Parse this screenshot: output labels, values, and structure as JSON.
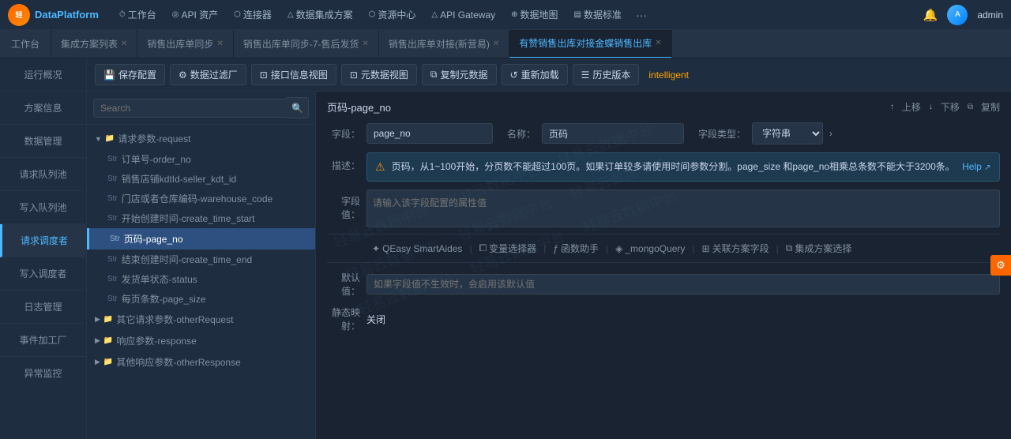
{
  "app": {
    "logo_text": "DataPlatform",
    "logo_short": "轻易云"
  },
  "topnav": {
    "items": [
      {
        "id": "workbench",
        "icon": "⏱",
        "label": "工作台"
      },
      {
        "id": "api",
        "icon": "◎",
        "label": "API 资产"
      },
      {
        "id": "connector",
        "icon": "⬡",
        "label": "连接器"
      },
      {
        "id": "data-integration",
        "icon": "△",
        "label": "数据集成方案"
      },
      {
        "id": "resource",
        "icon": "⬡",
        "label": "资源中心"
      },
      {
        "id": "api-gateway",
        "icon": "△",
        "label": "API Gateway"
      },
      {
        "id": "data-map",
        "icon": "⊕",
        "label": "数据地图"
      },
      {
        "id": "data-standard",
        "icon": "▤",
        "label": "数据标准"
      },
      {
        "id": "more",
        "icon": "···",
        "label": ""
      }
    ],
    "bell_icon": "🔔",
    "username": "admin"
  },
  "tabs": [
    {
      "id": "workbench",
      "label": "工作台",
      "closable": false,
      "active": false
    },
    {
      "id": "solution-list",
      "label": "集成方案列表",
      "closable": true,
      "active": false
    },
    {
      "id": "sales-sync",
      "label": "销售出库单同步",
      "closable": true,
      "active": false
    },
    {
      "id": "sales-sync-7",
      "label": "销售出库单同步-7-售后发货",
      "closable": true,
      "active": false
    },
    {
      "id": "sales-match",
      "label": "销售出库单对接(新营易)",
      "closable": true,
      "active": false
    },
    {
      "id": "sales-jinsale",
      "label": "有赞销售出库对接金蝶销售出库",
      "closable": true,
      "active": true
    }
  ],
  "sidebar": {
    "items": [
      {
        "id": "overview",
        "label": "运行概况",
        "active": false
      },
      {
        "id": "solution-info",
        "label": "方案信息",
        "active": false
      },
      {
        "id": "data-mgmt",
        "label": "数据管理",
        "active": false
      },
      {
        "id": "request-queue",
        "label": "请求队列池",
        "active": false
      },
      {
        "id": "write-queue",
        "label": "写入队列池",
        "active": false
      },
      {
        "id": "request-scheduler",
        "label": "请求调度者",
        "active": true
      },
      {
        "id": "write-scheduler",
        "label": "写入调度者",
        "active": false
      },
      {
        "id": "log-mgmt",
        "label": "日志管理",
        "active": false
      },
      {
        "id": "event-factory",
        "label": "事件加工厂",
        "active": false
      },
      {
        "id": "exception-monitor",
        "label": "异常监控",
        "active": false
      }
    ]
  },
  "toolbar": {
    "buttons": [
      {
        "id": "save-config",
        "icon": "💾",
        "label": "保存配置"
      },
      {
        "id": "data-filter",
        "icon": "⚙",
        "label": "数据过滤厂"
      },
      {
        "id": "interface-view",
        "icon": "⊡",
        "label": "接口信息视图"
      },
      {
        "id": "meta-view",
        "icon": "⊡",
        "label": "元数据视图"
      },
      {
        "id": "copy-meta",
        "icon": "⧉",
        "label": "复制元数据"
      },
      {
        "id": "reload",
        "icon": "↺",
        "label": "重新加载"
      },
      {
        "id": "history",
        "icon": "☰",
        "label": "历史版本"
      }
    ],
    "tag": "intelligent"
  },
  "search": {
    "placeholder": "Search"
  },
  "tree": {
    "sections": [
      {
        "id": "request-params",
        "label": "请求参数-request",
        "expanded": true,
        "items": [
          {
            "id": "order_no",
            "type": "Str",
            "label": "订单号-order_no",
            "active": false
          },
          {
            "id": "seller_kdt_id",
            "type": "Str",
            "label": "销售店铺kdtId-seller_kdt_id",
            "active": false
          },
          {
            "id": "warehouse_code",
            "type": "Str",
            "label": "门店或者仓库编码-warehouse_code",
            "active": false
          },
          {
            "id": "create_time_start",
            "type": "Str",
            "label": "开始创建时间-create_time_start",
            "active": false
          },
          {
            "id": "page_no",
            "type": "Str",
            "label": "页码-page_no",
            "active": true
          },
          {
            "id": "create_time_end",
            "type": "Str",
            "label": "结束创建时间-create_time_end",
            "active": false
          },
          {
            "id": "status",
            "type": "Str",
            "label": "发货单状态-status",
            "active": false
          },
          {
            "id": "page_size",
            "type": "Str",
            "label": "每页条数-page_size",
            "active": false
          }
        ]
      },
      {
        "id": "other-request",
        "label": "其它请求参数-otherRequest",
        "expanded": false,
        "items": []
      },
      {
        "id": "response-params",
        "label": "响应参数-response",
        "expanded": false,
        "items": []
      },
      {
        "id": "other-response",
        "label": "其他响应参数-otherResponse",
        "expanded": false,
        "items": []
      }
    ]
  },
  "detail": {
    "title": "页码-page_no",
    "actions": [
      "上移",
      "下移",
      "复制"
    ],
    "field_label": "字段：",
    "field_value": "page_no",
    "name_label": "名称：",
    "name_value": "页码",
    "type_label": "字段类型：",
    "type_value": "字符串",
    "desc_label": "描述：",
    "desc_text": "页码，从1~100开始，分页数不能超过100页。如果订单较多请使用时间参数分割。page_size 和page_no相乘总条数不能大于3200条。",
    "desc_help": "Help",
    "field_value_label": "字段值：",
    "field_value_placeholder": "请输入该字段配置的属性值",
    "action_buttons": [
      {
        "id": "qeasy",
        "icon": "✦",
        "label": "QEasy SmartAides"
      },
      {
        "id": "var-selector",
        "icon": "⧠",
        "label": "变量选择器"
      },
      {
        "id": "func-helper",
        "icon": "ƒ",
        "label": "函数助手"
      },
      {
        "id": "mongo-query",
        "icon": "◈",
        "label": "_mongoQuery"
      },
      {
        "id": "related-field",
        "icon": "⊞",
        "label": "关联方案字段"
      },
      {
        "id": "integration",
        "icon": "⧉",
        "label": "集成方案选择"
      }
    ],
    "default_label": "默认值：",
    "default_placeholder": "如果字段值不生效时，会启用该默认值",
    "static_label": "静态映射：",
    "static_value": "关闭"
  }
}
